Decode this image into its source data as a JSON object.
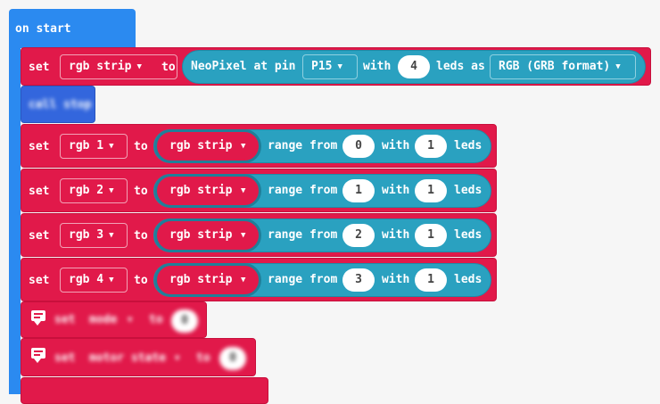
{
  "event": {
    "label": "on start"
  },
  "strip_block": {
    "set": "set",
    "var": "rgb strip",
    "to": "to",
    "neopixel_label": "NeoPixel at pin",
    "pin": "P15",
    "with": "with",
    "count": "4",
    "leds_as": "leds as",
    "format": "RGB (GRB format)"
  },
  "call_block": {
    "label": "call stop"
  },
  "range_blocks": [
    {
      "set": "set",
      "var": "rgb 1",
      "to": "to",
      "strip": "rgb strip",
      "range_from": "range from",
      "start": "0",
      "with": "with",
      "length": "1",
      "leds": "leds"
    },
    {
      "set": "set",
      "var": "rgb 2",
      "to": "to",
      "strip": "rgb strip",
      "range_from": "range from",
      "start": "1",
      "with": "with",
      "length": "1",
      "leds": "leds"
    },
    {
      "set": "set",
      "var": "rgb 3",
      "to": "to",
      "strip": "rgb strip",
      "range_from": "range from",
      "start": "2",
      "with": "with",
      "length": "1",
      "leds": "leds"
    },
    {
      "set": "set",
      "var": "rgb 4",
      "to": "to",
      "strip": "rgb strip",
      "range_from": "range from",
      "start": "3",
      "with": "with",
      "length": "1",
      "leds": "leds"
    }
  ],
  "blurred_blocks": [
    {
      "set": "set",
      "var": "mode",
      "to": "to",
      "value": "0"
    },
    {
      "set": "set",
      "var": "motor state",
      "to": "to",
      "value": "0"
    }
  ],
  "colors": {
    "event": "#2b8af0",
    "variables": "#e1194a",
    "neopixel": "#2aa1c0",
    "background": "#f6f6f6"
  }
}
